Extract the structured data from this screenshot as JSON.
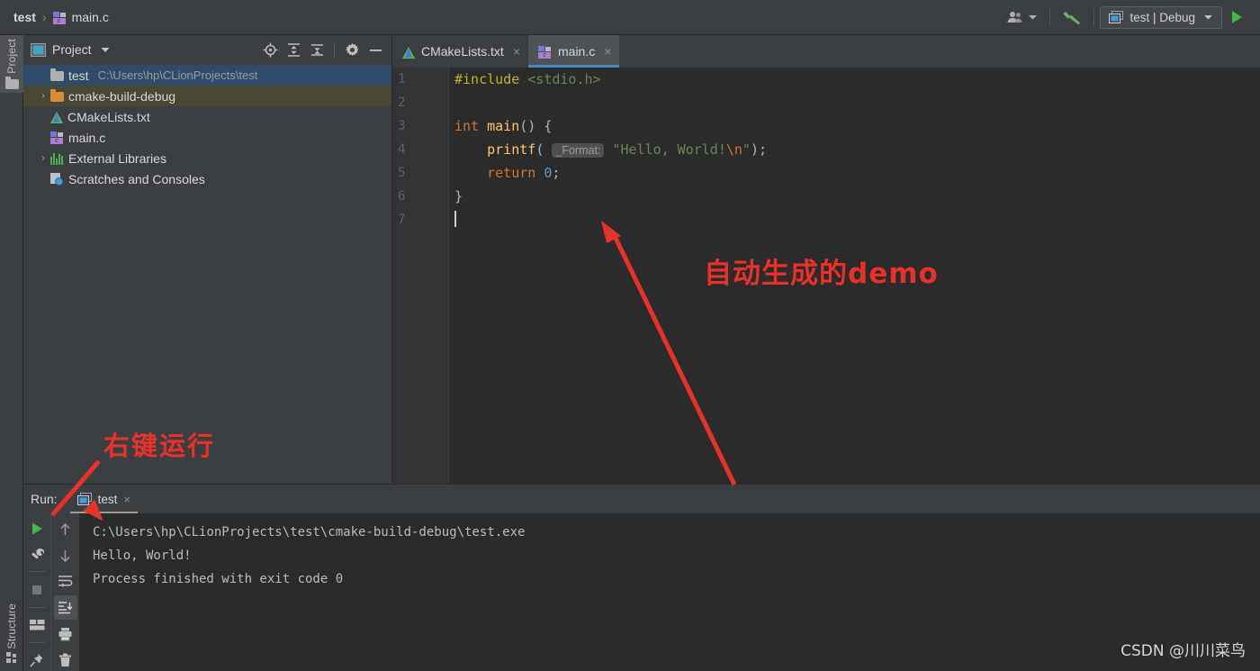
{
  "breadcrumb": {
    "project": "test",
    "separator": "›",
    "file": "main.c"
  },
  "toolbar": {
    "user_icon": "user-account-icon",
    "dropdown_icon": "chevron-down-icon",
    "build_icon": "hammer-icon",
    "run_config": "test | Debug",
    "run_icon": "run-triangle-icon"
  },
  "left_strip": {
    "project_tab": "Project",
    "structure_tab": "Structure"
  },
  "project_panel": {
    "title": "Project",
    "dropdown_icon": "chevron-down-icon",
    "icons": [
      "locate-target-icon",
      "expand-all-icon",
      "collapse-all-icon",
      "gear-icon",
      "minimize-icon"
    ],
    "tree": [
      {
        "name": "test",
        "path": "C:\\Users\\hp\\CLionProjects\\test",
        "icon": "folder-icon",
        "arrow": "ⱟ",
        "state": "selected",
        "indent": 0
      },
      {
        "name": "cmake-build-debug",
        "path": "",
        "icon": "folder-orange-icon",
        "arrow": "›",
        "state": "highlighted",
        "indent": 1
      },
      {
        "name": "CMakeLists.txt",
        "path": "",
        "icon": "cmake-file-icon",
        "arrow": "",
        "state": "",
        "indent": 1
      },
      {
        "name": "main.c",
        "path": "",
        "icon": "c-file-icon",
        "arrow": "",
        "state": "",
        "indent": 1
      },
      {
        "name": "External Libraries",
        "path": "",
        "icon": "libraries-icon",
        "arrow": "›",
        "state": "",
        "indent": 0
      },
      {
        "name": "Scratches and Consoles",
        "path": "",
        "icon": "scratches-icon",
        "arrow": "",
        "state": "",
        "indent": 0
      }
    ]
  },
  "editor": {
    "tabs": [
      {
        "label": "CMakeLists.txt",
        "icon": "cmake-file-icon",
        "active": false,
        "close": "×"
      },
      {
        "label": "main.c",
        "icon": "c-file-icon",
        "active": true,
        "close": "×"
      }
    ],
    "line_numbers": [
      "1",
      "2",
      "3",
      "4",
      "5",
      "6",
      "7"
    ],
    "run_gutter_line": 3,
    "code": {
      "l1_include": "#include",
      "l1_header": " <stdio.h>",
      "l3_kw": "int",
      "l3_fn": " main",
      "l3_rest": "() {",
      "l4_indent": "    ",
      "l4_fn": "printf",
      "l4_paren": "( ",
      "l4_hint": "_Format:",
      "l4_str": " \"Hello, World!",
      "l4_esc": "\\n",
      "l4_str2": "\"",
      "l4_end": ");",
      "l5_indent": "    ",
      "l5_kw": "return",
      "l5_num": " 0",
      "l5_semi": ";",
      "l6_brace": "}"
    }
  },
  "run_panel": {
    "label": "Run:",
    "tab_label": "test",
    "tab_close": "×",
    "tab_icon": "run-config-icon",
    "left_icons": [
      "rerun-icon",
      "wrench-icon",
      "stop-icon",
      "layout-icon",
      "pin-icon"
    ],
    "right_icons": [
      "scroll-up-icon",
      "scroll-down-icon",
      "soft-wrap-icon",
      "scroll-to-end-icon",
      "print-icon",
      "trash-icon"
    ],
    "active_right_icon": "scroll-to-end-icon",
    "console_lines": [
      "C:\\Users\\hp\\CLionProjects\\test\\cmake-build-debug\\test.exe",
      "Hello, World!",
      "",
      "Process finished with exit code 0"
    ]
  },
  "annotations": {
    "demo": "自动生成的demo",
    "run": "右键运行",
    "color": "#e8312a"
  },
  "watermark": "CSDN @川川菜鸟"
}
